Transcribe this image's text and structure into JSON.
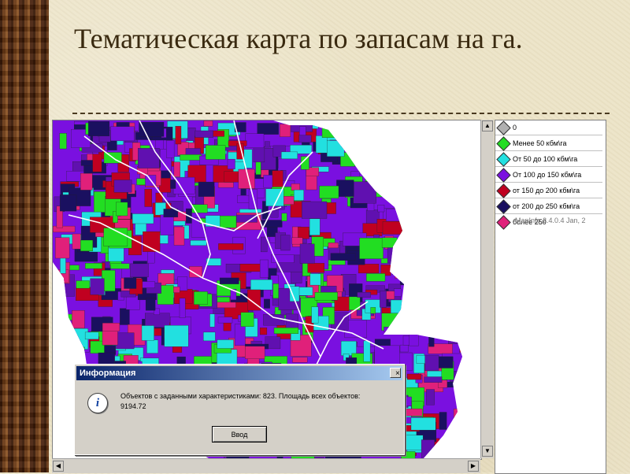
{
  "slide": {
    "title": "Тематическая карта по запасам на га."
  },
  "legend": {
    "items": [
      {
        "label": "0",
        "color": "#b0b0b0"
      },
      {
        "label": "Менее 50 кбм\\га",
        "color": "#22dd22"
      },
      {
        "label": "От 50 до 100 кбм\\га",
        "color": "#22e0e0"
      },
      {
        "label": "От 100 до 150 кбм\\га",
        "color": "#7a10e0"
      },
      {
        "label": "от 150 до 200 кбм\\га",
        "color": "#c00020"
      },
      {
        "label": "от 200 до 250 кбм\\га",
        "color": "#1a1060"
      },
      {
        "label": "более 250",
        "color": "#e0207a"
      }
    ],
    "ghost_text": "MapInfo 2.4.0.4 Jan, 2"
  },
  "map": {
    "palette": [
      "#7a10e0",
      "#22e0e0",
      "#c00020",
      "#1a1060",
      "#e0207a",
      "#22dd22",
      "#6010b0"
    ]
  },
  "dialog": {
    "title": "Информация",
    "close_label": "×",
    "icon": "info-icon",
    "message_line1": "Объектов с заданными характеристиками: 823. Площадь всех объектов:",
    "message_line2": "9194.72",
    "ok_label": "Ввод"
  },
  "scrollbars": {
    "up_arrow": "▲",
    "down_arrow": "▼",
    "left_arrow": "◀",
    "right_arrow": "▶"
  }
}
